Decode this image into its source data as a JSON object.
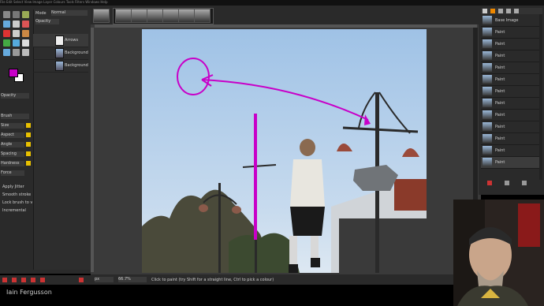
{
  "menubar": {
    "text": "File  Edit  Select  View  Image  Layer  Colours  Tools  Filters  Windows  Help"
  },
  "layers": {
    "mode_label": "Mode",
    "mode_value": "Normal",
    "opacity_label": "Opacity",
    "items": [
      {
        "label": "Arrows"
      },
      {
        "label": "Background copy"
      },
      {
        "label": "Background"
      }
    ]
  },
  "tool_options": {
    "rows": [
      "Opacity",
      "Brush",
      "Size",
      "Aspect",
      "Angle",
      "Spacing",
      "Hardness",
      "Force"
    ],
    "checks": [
      "Apply Jitter",
      "Smooth stroke",
      "Lock brush to view",
      "Incremental"
    ]
  },
  "history": {
    "items": [
      "Base Image",
      "Paint",
      "Paint",
      "Paint",
      "Paint",
      "Paint",
      "Paint",
      "Paint",
      "Paint",
      "Paint",
      "Paint",
      "Paint",
      "Paint"
    ]
  },
  "status": {
    "unit": "px",
    "zoom": "66.7%",
    "message": "Click to paint (try Shift for a straight line, Ctrl to pick a colour)"
  },
  "caption": {
    "name": "Iain Fergusson"
  },
  "colors": {
    "accent": "#c800c8",
    "panel": "#2b2b2b",
    "canvas_bg": "#3a3a3a"
  }
}
